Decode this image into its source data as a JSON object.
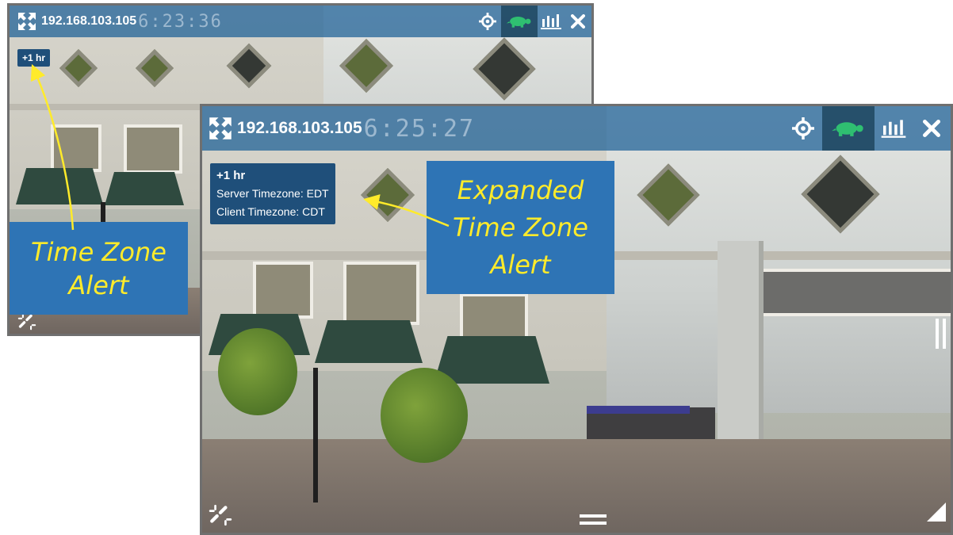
{
  "viewer_small": {
    "ip": "192.168.103.105",
    "clock": "6:23:36",
    "tz_offset": "+1 hr"
  },
  "viewer_large": {
    "ip": "192.168.103.105",
    "clock": "6:25:27",
    "tz_offset": "+1 hr",
    "server_tz_label": "Server Timezone:",
    "server_tz_value": "EDT",
    "client_tz_label": "Client Timezone:",
    "client_tz_value": "CDT"
  },
  "callouts": {
    "small": [
      "Time Zone",
      "Alert"
    ],
    "large": [
      "Expanded",
      "Time Zone",
      "Alert"
    ]
  },
  "icons": {
    "expand": "expand-icon",
    "ptz": "crosshair-icon",
    "turtle": "turtle-icon",
    "stats": "bar-chart-icon",
    "close": "close-icon",
    "disconnect": "broken-link-icon",
    "menu": "hamburger-icon",
    "pause": "pause-icon",
    "resize": "resize-corner-icon"
  },
  "colors": {
    "toolbar": "#1a5e96",
    "callout_bg": "#2e74b5",
    "callout_text": "#ffeb2a",
    "turtle": "#2fbf71",
    "tz_bg": "#1f4f7a"
  }
}
